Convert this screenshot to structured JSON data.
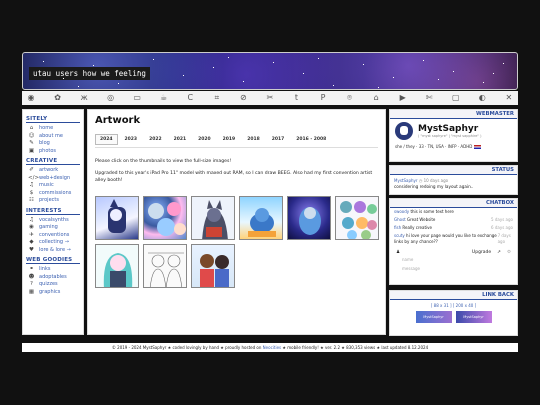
{
  "banner": {
    "title": "utau users how we feeling"
  },
  "icons": [
    "toyhouse-icon",
    "paw-icon",
    "butterfly-icon",
    "mastodon-icon",
    "twitch-icon",
    "kofi-icon",
    "carrd-icon",
    "crop-icon",
    "pencil-icon",
    "tools-icon",
    "tumblr-icon",
    "paypal-icon",
    "github-icon",
    "home-icon",
    "youtube-icon",
    "scissors-icon",
    "computer-icon",
    "discord-icon",
    "x-icon"
  ],
  "sidebar": {
    "sitely_heading": "SITELY",
    "sitely": [
      {
        "icon": "⌂",
        "label": "home"
      },
      {
        "icon": "☺",
        "label": "about me"
      },
      {
        "icon": "✎",
        "label": "blog"
      },
      {
        "icon": "▣",
        "label": "photos"
      }
    ],
    "creative_heading": "CREATIVE",
    "creative": [
      {
        "icon": "✐",
        "label": "artwork"
      },
      {
        "icon": "</>",
        "label": "web+design"
      },
      {
        "icon": "♫",
        "label": "music"
      },
      {
        "icon": "$",
        "label": "commissions"
      },
      {
        "icon": "☷",
        "label": "projects"
      }
    ],
    "interests_heading": "INTERESTS",
    "interests": [
      {
        "icon": "♫",
        "label": "vocalsynths"
      },
      {
        "icon": "◉",
        "label": "gaming"
      },
      {
        "icon": "✈",
        "label": "conventions"
      },
      {
        "icon": "◆",
        "label": "collecting →"
      },
      {
        "icon": "♥",
        "label": "lore & lore →"
      }
    ],
    "goodies_heading": "WEB GOODIES",
    "goodies": [
      {
        "icon": "⚭",
        "label": "links"
      },
      {
        "icon": "☻",
        "label": "adoptables"
      },
      {
        "icon": "?",
        "label": "quizzes"
      },
      {
        "icon": "▦",
        "label": "graphics"
      }
    ]
  },
  "main": {
    "title": "Artwork",
    "years": [
      "2024",
      "2023",
      "2022",
      "2021",
      "2020",
      "2019",
      "2018",
      "2017",
      "2016 - 2008"
    ],
    "text1": "Please click on the thumbnails to view the full-size images!",
    "text2": "Upgraded to this year's iPad Pro 11\" model with maxed out RAM, so I can draw BEEG. Also had my first convention artist alley booth!"
  },
  "webmaster": {
    "heading": "WEBMASTER",
    "name": "MystSaphyr",
    "sub": "( \"myst saphyre\" | \"myst sapphire\" )",
    "info": "she / they · 33 · TN, USA · INFP · ADHD"
  },
  "status": {
    "heading": "STATUS",
    "user": "MystSaphyr",
    "time": "10 days ago",
    "text": "considering redoing my layout again.."
  },
  "chatbox": {
    "heading": "CHATBOX",
    "messages": [
      {
        "user": "swoody",
        "text": "this is some text here",
        "time": ""
      },
      {
        "user": "Ghost",
        "text": "Great Website",
        "time": "5 days ago"
      },
      {
        "user": "fish",
        "text": "Really creative",
        "time": "6 days ago"
      },
      {
        "user": "scuty",
        "text": "hi love your page would you like to exchange links by any chance??",
        "time": "7 days ago"
      }
    ],
    "upgrade_label": "Upgrade",
    "name_placeholder": "name",
    "message_placeholder": "message"
  },
  "linkback": {
    "heading": "LINK BACK",
    "tabs": "[ 88 x 31 ]   [ 200 x 40 ]",
    "button_small": "MystSaphyr",
    "button_large": "MystSaphyr"
  },
  "footer": {
    "part1": "© 2019 - 2024 MystSaphyr  ★  coded lovingly by hand  ★  proudly hosted on ",
    "host": "Neocities",
    "part2": "  ★  mobile friendly!  ★  ver. 2.2  ★  830,353 views  ★  last updated 8.12.2024"
  }
}
